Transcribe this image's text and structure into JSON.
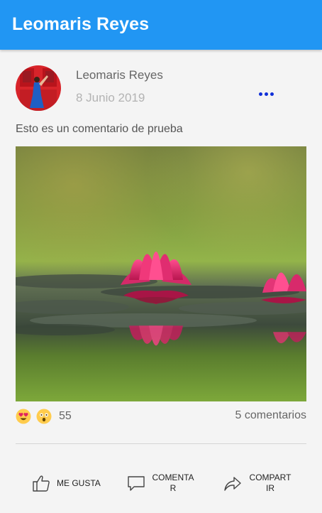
{
  "appbar": {
    "title": "Leomaris Reyes",
    "color": "#2196f3"
  },
  "post": {
    "author": "Leomaris Reyes",
    "date": "8 Junio 2019",
    "comment": "Esto es un comentario de prueba",
    "avatar": "user-avatar-photo",
    "image": "pink-water-lily-photo"
  },
  "reactions": {
    "icons": [
      "heart-eyes-emoji",
      "surprised-emoji"
    ],
    "count": "55",
    "comments": "5 comentarios"
  },
  "actions": {
    "like": {
      "label": "ME GUSTA",
      "icon": "thumbs-up-icon"
    },
    "comment": {
      "label": "COMENTA R",
      "icon": "comment-icon"
    },
    "share": {
      "label": "COMPART IR",
      "icon": "share-icon"
    }
  },
  "menu_icon": "more-options-icon"
}
